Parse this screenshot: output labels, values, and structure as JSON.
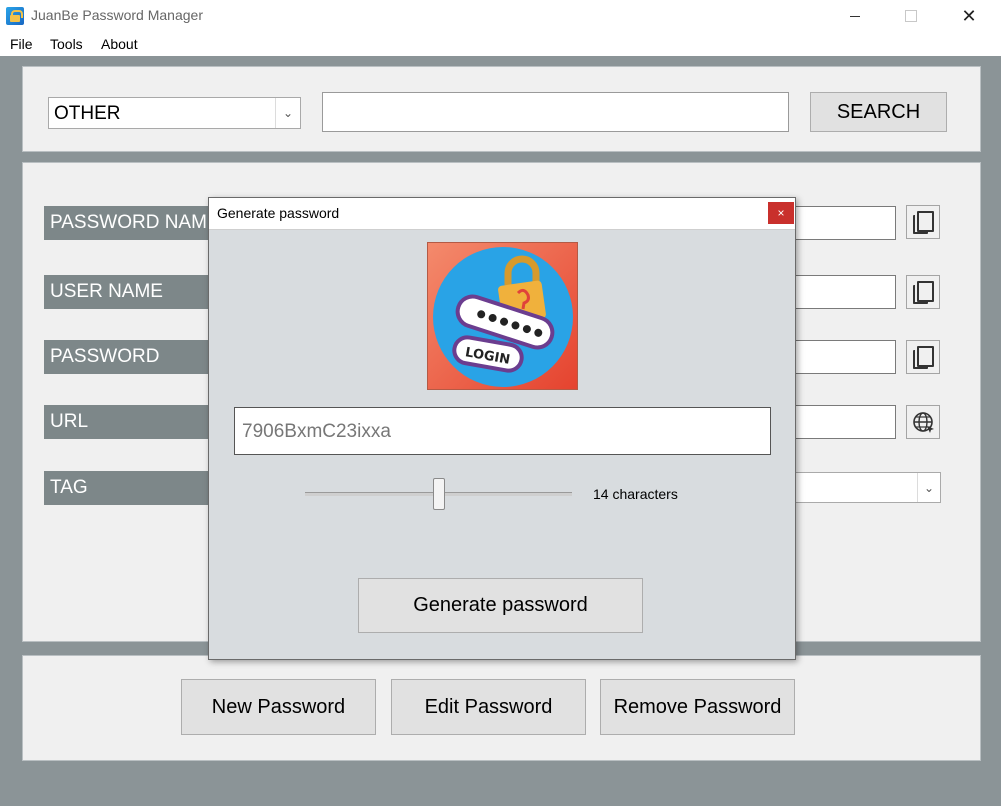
{
  "window": {
    "title": "JuanBe Password Manager",
    "close_glyph": "✕"
  },
  "menu": {
    "items": [
      "File",
      "Tools",
      "About"
    ]
  },
  "search": {
    "category_value": "OTHER",
    "query_value": "",
    "button_label": "SEARCH"
  },
  "fields": {
    "password_name_label": "PASSWORD NAME",
    "user_name_label": "USER NAME",
    "password_label": "PASSWORD",
    "url_label": "URL",
    "tag_label": "TAG"
  },
  "actions": {
    "new_label": "New Password",
    "edit_label": "Edit Password",
    "remove_label": "Remove Password"
  },
  "dialog": {
    "title": "Generate password",
    "close_glyph": "×",
    "logo_text": "LOGIN",
    "generated_password": "7906BxmC23ixxa",
    "length_value": 14,
    "length_min": 4,
    "length_max": 24,
    "length_label": "14 characters",
    "generate_button_label": "Generate password"
  },
  "icons": {
    "copy": "copy-icon",
    "globe": "globe-icon",
    "dropdown_arrow": "chevron-down-icon"
  },
  "colors": {
    "label_bg": "#7d8789",
    "main_bg": "#8b9497",
    "close_red": "#c9302c"
  }
}
